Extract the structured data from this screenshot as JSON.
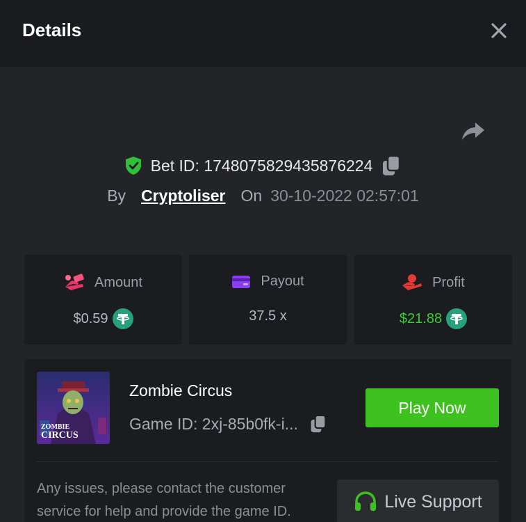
{
  "header": {
    "title": "Details"
  },
  "bet": {
    "id_text": "Bet ID: 1748075829435876224",
    "by_label": "By",
    "username": "Cryptoliser",
    "on_label": "On",
    "datetime": "30-10-2022 02:57:01"
  },
  "stats": {
    "amount": {
      "label": "Amount",
      "value": "$0.59",
      "icon": "cash-hand-icon",
      "currency_icon": "tether-icon"
    },
    "payout": {
      "label": "Payout",
      "value": "37.5 x",
      "icon": "credit-card-icon"
    },
    "profit": {
      "label": "Profit",
      "value": "$21.88",
      "icon": "money-hand-icon",
      "currency_icon": "tether-icon"
    }
  },
  "game": {
    "name": "Zombie Circus",
    "id_text": "Game ID: 2xj-85b0fk-i...",
    "thumb_title_line1": "ZOMBIE",
    "thumb_title_line2": "CIRCUS",
    "play_label": "Play Now"
  },
  "support": {
    "help_text": "Any issues, please contact the customer service for help and provide the game ID.",
    "button_label": "Live Support"
  },
  "colors": {
    "accent_green": "#3cc11f",
    "profit_green": "#3ec936",
    "shield_green": "#2fbf3a",
    "amount_pink": "#e8336b",
    "payout_purple": "#8b3df0",
    "profit_red": "#e53935",
    "tether": "#26a17b"
  }
}
